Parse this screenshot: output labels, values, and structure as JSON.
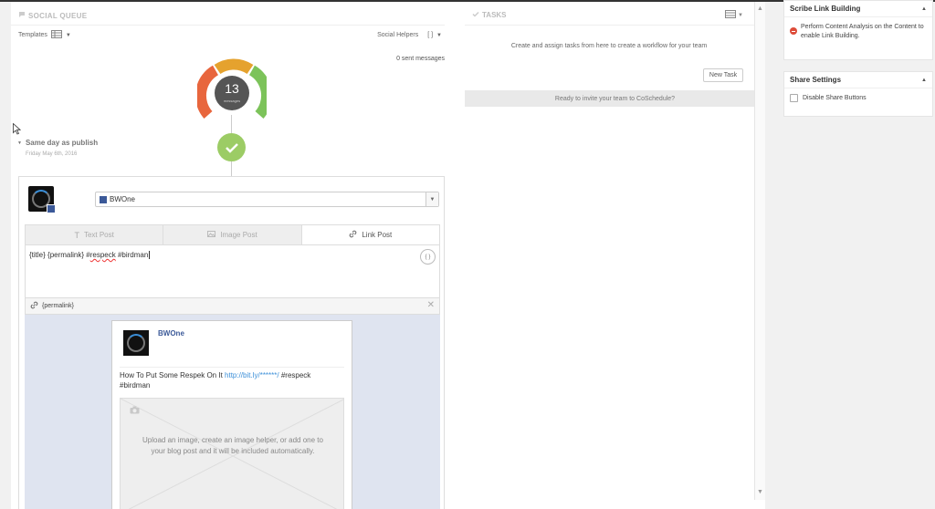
{
  "social_queue": {
    "title": "SOCIAL QUEUE",
    "templates_label": "Templates",
    "social_helpers_label": "Social Helpers",
    "social_helpers_value": "[ ]",
    "sent_messages": "0 sent messages",
    "gauge_count": "13",
    "gauge_unit": "messages",
    "schedule_label": "Same day as publish",
    "schedule_date": "Friday May 6th, 2016"
  },
  "post": {
    "account_name": "BWOne",
    "tabs": [
      {
        "label": "Text Post",
        "icon": "text-icon"
      },
      {
        "label": "Image Post",
        "icon": "image-icon"
      },
      {
        "label": "Link Post",
        "icon": "link-icon"
      }
    ],
    "active_tab": "Link Post",
    "message_prefix": "{title} {permalink} #",
    "message_misspelled": "respeck",
    "message_suffix": " #birdman",
    "braces_label": "{ }",
    "link_value": "{permalink}",
    "preview": {
      "name": "BWOne",
      "text_before": "How To Put Some Respek On It ",
      "link": "http://bit.ly/******/",
      "text_after": " #respeck #birdman",
      "image_placeholder": "Upload an image, create an image helper, or add one to your blog post and it will be included automatically."
    }
  },
  "tasks": {
    "title": "TASKS",
    "description": "Create and assign tasks from here to create a workflow for your team",
    "new_task_label": "New Task",
    "invite_text": "Ready to invite your team to CoSchedule?"
  },
  "sidebar": {
    "scribe": {
      "title": "Scribe Link Building",
      "message": "Perform Content Analysis on the Content to enable Link Building."
    },
    "share": {
      "title": "Share Settings",
      "checkbox_label": "Disable Share Buttons"
    }
  },
  "colors": {
    "gauge_red": "#e8663d",
    "gauge_orange": "#e5a22e",
    "gauge_green": "#7cc35a",
    "check_green": "#9ccc65",
    "facebook_blue": "#3b5998",
    "link_blue": "#3b8fd8"
  }
}
